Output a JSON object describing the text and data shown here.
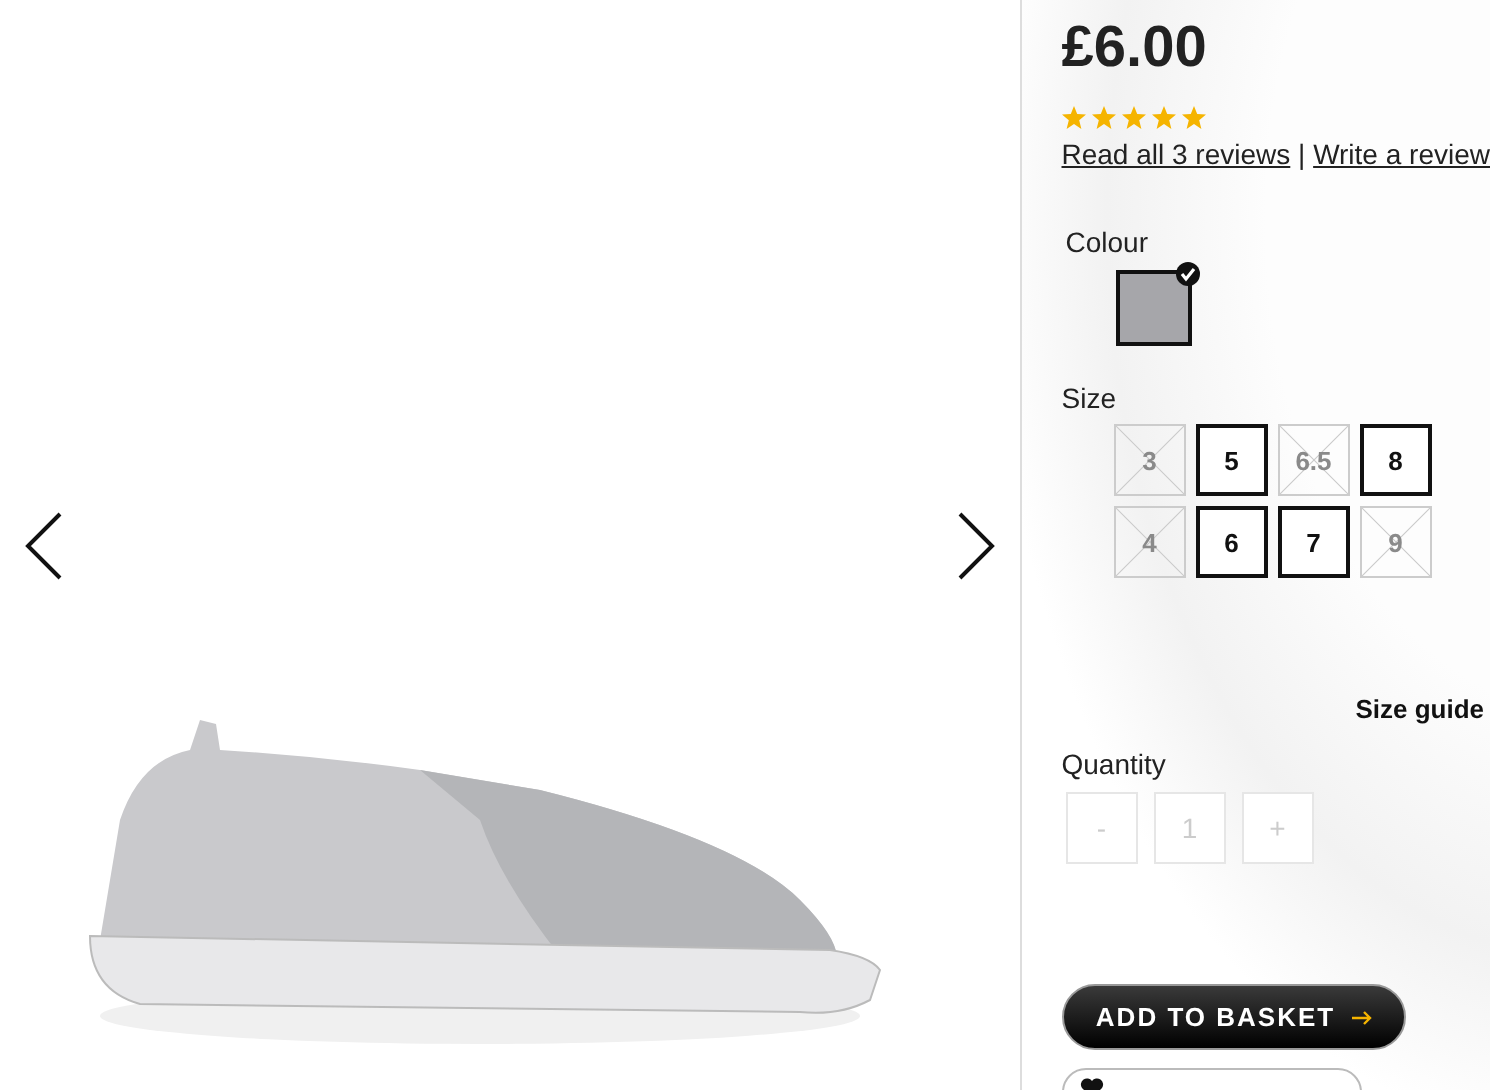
{
  "product": {
    "price": "£6.00",
    "stars": 5,
    "read_reviews": "Read all 3 reviews",
    "separator": "|",
    "write_review": "Write a review"
  },
  "colour": {
    "label": "Colour",
    "swatches": [
      {
        "color": "#a6a6aa",
        "selected": true
      }
    ]
  },
  "size": {
    "label": "Size",
    "options": [
      {
        "label": "3",
        "available": false
      },
      {
        "label": "5",
        "available": true
      },
      {
        "label": "6.5",
        "available": false
      },
      {
        "label": "8",
        "available": true
      },
      {
        "label": "4",
        "available": false
      },
      {
        "label": "6",
        "available": true
      },
      {
        "label": "7",
        "available": true
      },
      {
        "label": "9",
        "available": false
      }
    ],
    "guide": "Size guide"
  },
  "quantity": {
    "label": "Quantity",
    "minus": "-",
    "value": "1",
    "plus": "+"
  },
  "add_to_basket": "ADD TO BASKET"
}
